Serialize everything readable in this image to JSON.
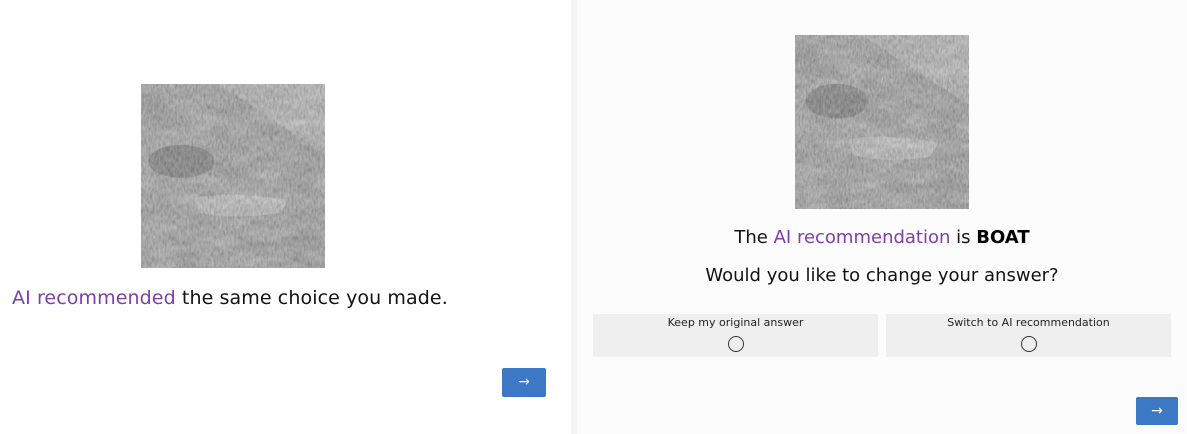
{
  "left_panel": {
    "stimulus_image": "grayscale-noise-boat-image",
    "message_accent": "AI recommended",
    "message_rest": " the same choice you made.",
    "next_button_label": "→"
  },
  "right_panel": {
    "stimulus_image": "grayscale-noise-boat-image",
    "recommendation_prefix": "The ",
    "recommendation_accent": "AI recommendation",
    "recommendation_mid": " is ",
    "recommendation_value": "BOAT",
    "question": "Would you like to change your answer?",
    "options": [
      {
        "label": "Keep my original answer",
        "selected": false
      },
      {
        "label": "Switch to AI recommendation",
        "selected": false
      }
    ],
    "next_button_label": "→"
  },
  "colors": {
    "accent": "#7e3ea8",
    "button": "#3d78c4",
    "option_background": "#efefef"
  }
}
